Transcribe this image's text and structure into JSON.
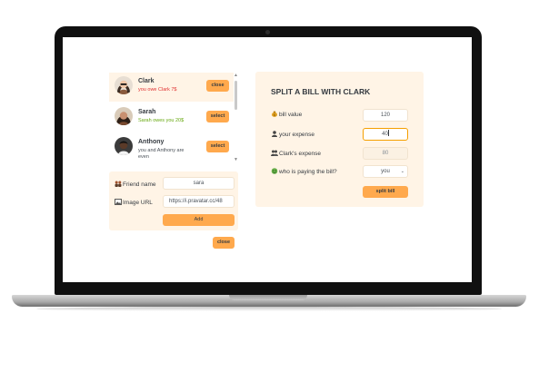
{
  "colors": {
    "accent": "#ffa94d",
    "panel": "#fff4e6",
    "owe": "#e03131",
    "owed": "#66a80f"
  },
  "friends": [
    {
      "name": "Clark",
      "status": "you owe Clark 7$",
      "status_kind": "red",
      "button": "close",
      "selected": true
    },
    {
      "name": "Sarah",
      "status": "Sarah owes you 20$",
      "status_kind": "green",
      "button": "select",
      "selected": false
    },
    {
      "name": "Anthony",
      "status": "you and Anthony are even",
      "status_kind": "gray",
      "button": "select",
      "selected": false
    }
  ],
  "add_form": {
    "name_label": "Friend name",
    "name_value": "sara",
    "name_icon": "people-icon",
    "url_label": "Image URL",
    "url_value": "https://i.pravatar.cc/48",
    "url_icon": "picture-icon",
    "add_button": "Add"
  },
  "close_form_button": "close",
  "split": {
    "title": "SPLIT A BILL WITH CLARK",
    "bill_label": "bill value",
    "bill_value": "120",
    "expense_label": "your expense",
    "expense_value": "40",
    "friend_expense_label": "Clark's expense",
    "friend_expense_value": "80",
    "payer_label": "who is paying the bill?",
    "payer_value": "you",
    "submit": "split bill"
  }
}
